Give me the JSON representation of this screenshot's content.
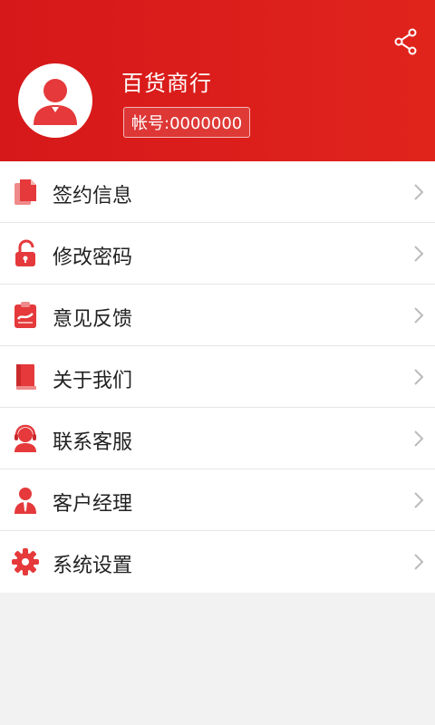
{
  "profile": {
    "shop_name": "百货商行",
    "account_label": "帐号:0000000"
  },
  "menu": {
    "items": [
      {
        "label": "签约信息",
        "icon": "documents-icon"
      },
      {
        "label": "修改密码",
        "icon": "unlock-icon"
      },
      {
        "label": "意见反馈",
        "icon": "feedback-clipboard-icon"
      },
      {
        "label": "关于我们",
        "icon": "book-icon"
      },
      {
        "label": "联系客服",
        "icon": "headset-agent-icon"
      },
      {
        "label": "客户经理",
        "icon": "manager-icon"
      },
      {
        "label": "系统设置",
        "icon": "gear-icon"
      }
    ]
  },
  "colors": {
    "header": "#d6181a",
    "icon": "#e5393b",
    "text": "#222222",
    "chevron": "#bbbbbb",
    "background": "#f2f2f2"
  }
}
